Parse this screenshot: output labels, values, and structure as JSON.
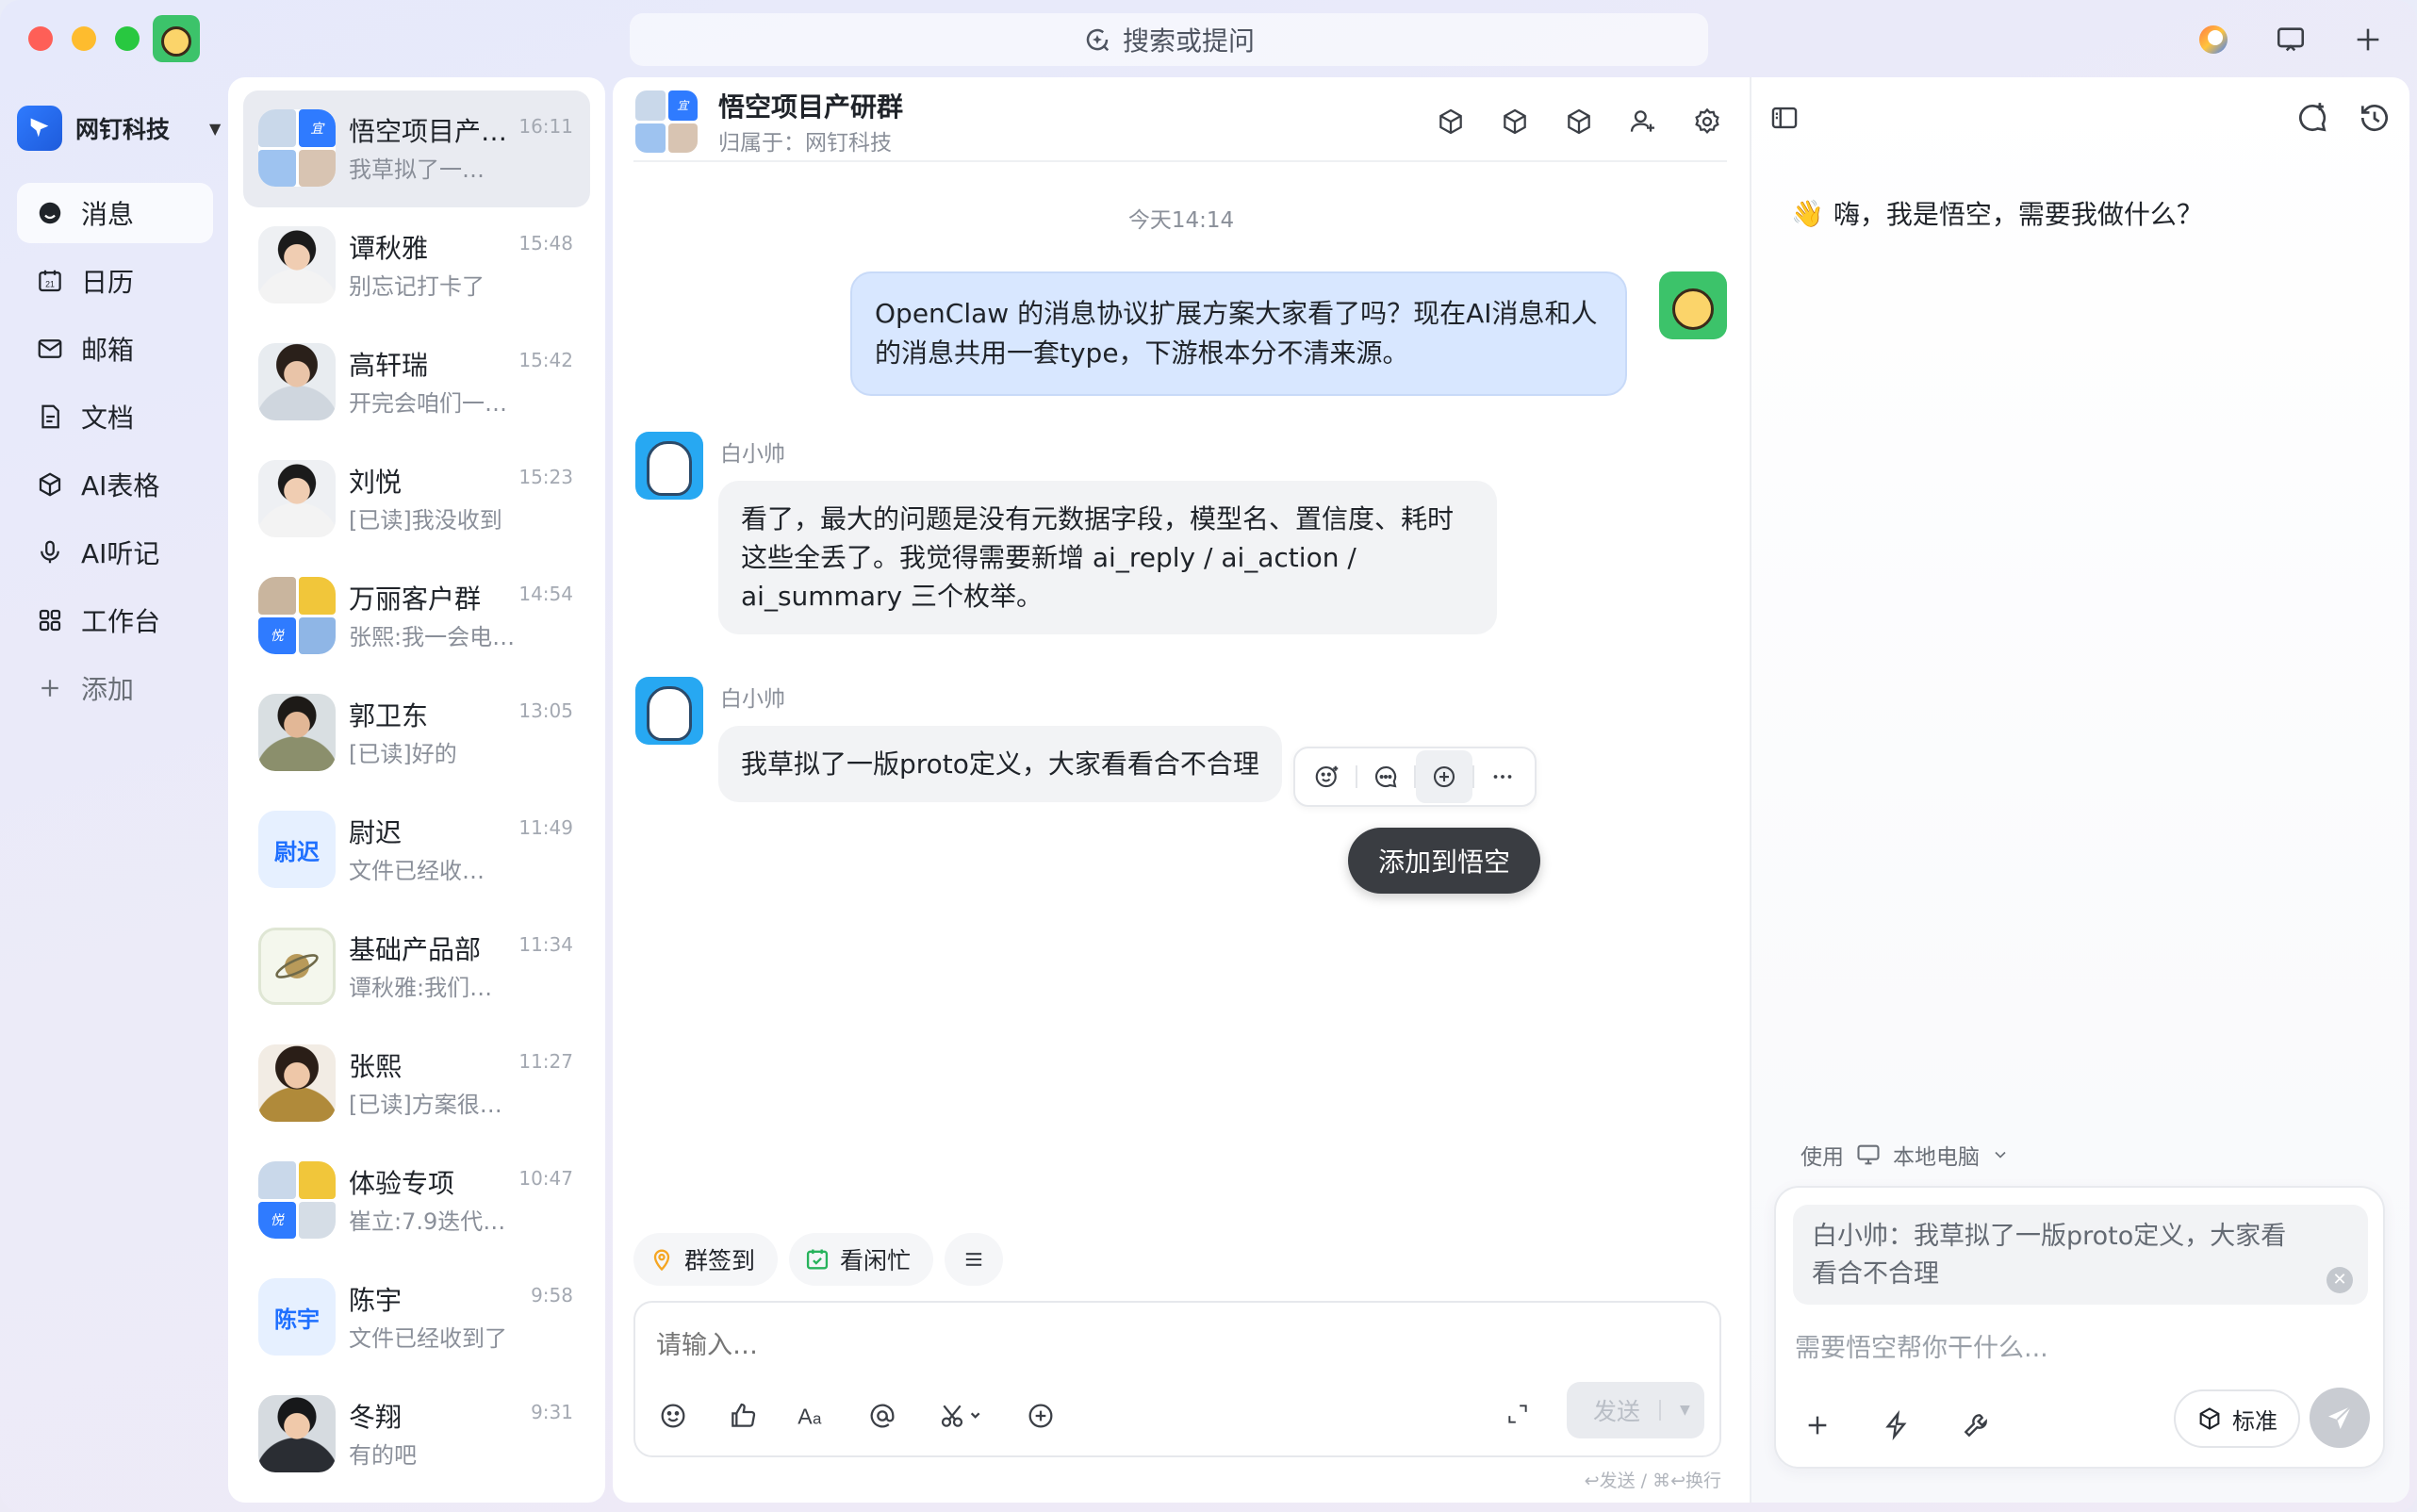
{
  "topbar": {
    "search_label": "搜索或提问"
  },
  "org": {
    "name": "网钉科技"
  },
  "nav": {
    "items": [
      {
        "label": "消息",
        "icon": "chat-bubble-icon",
        "active": true
      },
      {
        "label": "日历",
        "icon": "calendar-icon"
      },
      {
        "label": "邮箱",
        "icon": "mail-icon"
      },
      {
        "label": "文档",
        "icon": "document-icon"
      },
      {
        "label": "AI表格",
        "icon": "ai-table-icon"
      },
      {
        "label": "AI听记",
        "icon": "ai-note-icon"
      },
      {
        "label": "工作台",
        "icon": "workbench-icon"
      }
    ],
    "add_label": "添加",
    "calendar_day": "21"
  },
  "conversations": [
    {
      "name": "悟空项目产…",
      "time": "16:11",
      "preview": "我草拟了一…",
      "avatar": "group",
      "active": true
    },
    {
      "name": "谭秋雅",
      "time": "15:48",
      "preview": "别忘记打卡了",
      "avatar": "person-2"
    },
    {
      "name": "高轩瑞",
      "time": "15:42",
      "preview": "开完会咱们一…",
      "avatar": "person-3"
    },
    {
      "name": "刘悦",
      "time": "15:23",
      "preview": "[已读]我没收到",
      "avatar": "person-2"
    },
    {
      "name": "万丽客户群",
      "time": "14:54",
      "preview": "张熙:我一会电…",
      "avatar": "group"
    },
    {
      "name": "郭卫东",
      "time": "13:05",
      "preview": "[已读]好的",
      "avatar": "person-4"
    },
    {
      "name": "尉迟",
      "time": "11:49",
      "preview": "文件已经收…",
      "avatar": "text",
      "avatar_text": "尉迟"
    },
    {
      "name": "基础产品部",
      "time": "11:34",
      "preview": "谭秋雅:我们…",
      "avatar": "planet"
    },
    {
      "name": "张熙",
      "time": "11:27",
      "preview": "[已读]方案很…",
      "avatar": "person-5"
    },
    {
      "name": "体验专项",
      "time": "10:47",
      "preview": "崔立:7.9迭代…",
      "avatar": "group"
    },
    {
      "name": "陈宇",
      "time": "9:58",
      "preview": "文件已经收到了",
      "avatar": "text",
      "avatar_text": "陈宇"
    },
    {
      "name": "冬翔",
      "time": "9:31",
      "preview": "有的吧",
      "avatar": "person-6"
    }
  ],
  "group_badges": {
    "yi": "宜",
    "yue": "悦"
  },
  "chat": {
    "title": "悟空项目产研群",
    "subtitle": "归属于：网钉科技",
    "day_label": "今天14:14",
    "messages": [
      {
        "from": "me",
        "text": "OpenClaw 的消息协议扩展方案大家看了吗？现在AI消息和人的消息共用一套type，下游根本分不清来源。"
      },
      {
        "from": "白小帅",
        "text": "看了，最大的问题是没有元数据字段，模型名、置信度、耗时这些全丢了。我觉得需要新增 ai_reply / ai_action / ai_summary 三个枚举。"
      },
      {
        "from": "白小帅",
        "text": "我草拟了一版proto定义，大家看看合不合理"
      }
    ],
    "tooltip": "添加到悟空",
    "quick_actions": [
      "群签到",
      "看闲忙"
    ],
    "input_placeholder": "请输入…",
    "send_label": "发送",
    "send_hint": "↩发送 / ⌘↩换行"
  },
  "assistant": {
    "greeting": "嗨，我是悟空，需要我做什么？",
    "greeting_emoji": "👋",
    "use_label": "使用",
    "device_label": "本地电脑",
    "quote_text": "白小帅：我草拟了一版proto定义，大家看看合不合理",
    "placeholder": "需要悟空帮你干什么...",
    "mode_label": "标准"
  },
  "colors": {
    "accent": "#1e6fff",
    "bubble_me": "#d8e7ff",
    "bubble_other": "#f2f3f5",
    "tooltip_bg": "#3a3d42"
  }
}
